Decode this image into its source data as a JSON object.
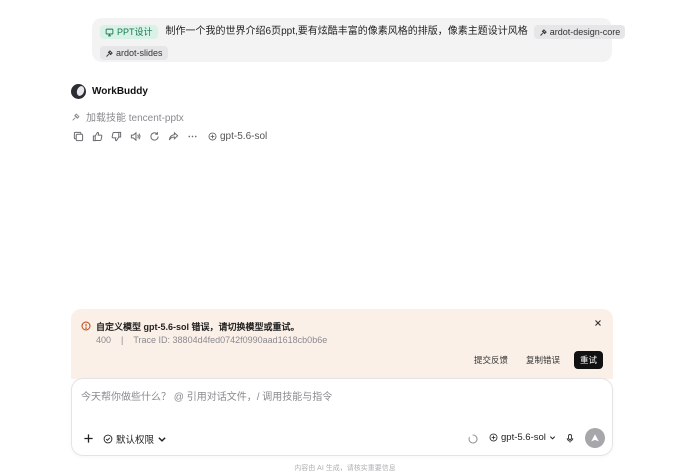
{
  "user_message": {
    "tag": "PPT设计",
    "text": "制作一个我的世界介绍6页ppt,要有炫酷丰富的像素风格的排版，像素主题设计风格",
    "skills": [
      "ardot-design-core",
      "ardot-slides"
    ]
  },
  "agent": {
    "name": "WorkBuddy",
    "skill_load_text": "加载技能 tencent-pptx",
    "model": "gpt-5.6-sol"
  },
  "icons": {
    "actions": [
      "copy-icon",
      "thumbs-up-icon",
      "thumbs-down-icon",
      "speaker-icon",
      "refresh-icon",
      "share-icon",
      "more-icon"
    ]
  },
  "error": {
    "title": "自定义模型 gpt-5.6-sol 错误，请切换模型或重试。",
    "code": "400",
    "separator": "|",
    "trace": "Trace ID: 38804d4fed0742f0990aad1618cb0b6e",
    "feedback_label": "提交反馈",
    "copy_label": "复制错误",
    "retry_label": "重试",
    "accent_color": "#c2410c",
    "bg_color": "#fbf0e8"
  },
  "composer": {
    "placeholder": "今天帮你做些什么？ @ 引用对话文件，/ 调用技能与指令",
    "permission_label": "默认权限",
    "model_label": "gpt-5.6-sol"
  },
  "footer": {
    "note": "内容由 AI 生成，请核实重要信息"
  }
}
